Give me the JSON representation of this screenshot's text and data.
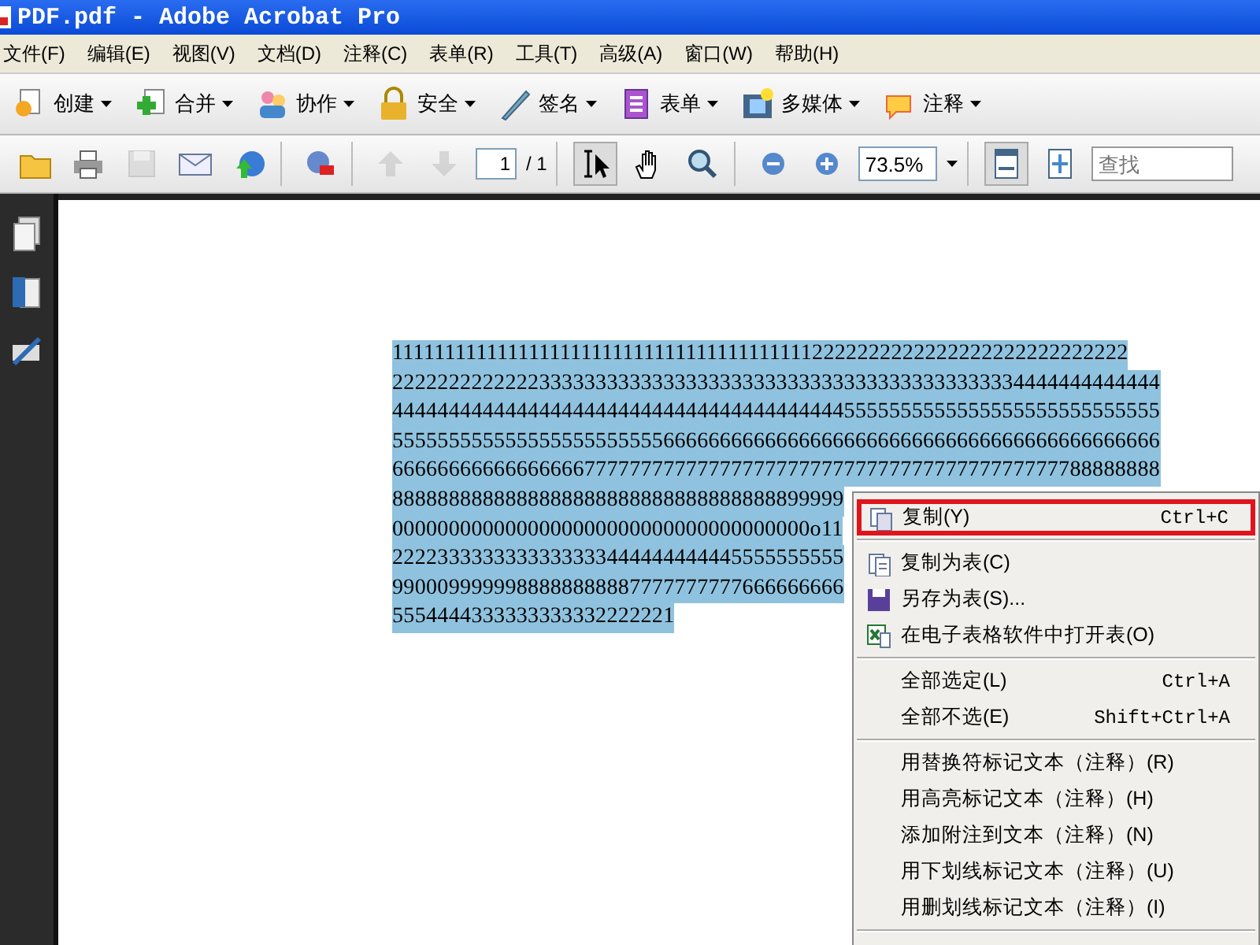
{
  "window": {
    "title": "PDF.pdf - Adobe Acrobat Pro"
  },
  "menu_bar": [
    "文件(F)",
    "编辑(E)",
    "视图(V)",
    "文档(D)",
    "注释(C)",
    "表单(R)",
    "工具(T)",
    "高级(A)",
    "窗口(W)",
    "帮助(H)"
  ],
  "task_toolbar": [
    {
      "label": "创建"
    },
    {
      "label": "合并"
    },
    {
      "label": "协作"
    },
    {
      "label": "安全"
    },
    {
      "label": "签名"
    },
    {
      "label": "表单"
    },
    {
      "label": "多媒体"
    },
    {
      "label": "注释"
    }
  ],
  "file_toolbar": [
    [
      {
        "kind": "button",
        "disabled": false,
        "pressed": false
      },
      {
        "kind": "button",
        "disabled": false,
        "pressed": false
      },
      {
        "kind": "button",
        "disabled": true,
        "pressed": false
      },
      {
        "kind": "button",
        "disabled": false,
        "pressed": false
      },
      {
        "kind": "button",
        "disabled": false,
        "pressed": false
      }
    ],
    [
      {
        "kind": "button",
        "disabled": false,
        "pressed": false
      }
    ],
    [
      {
        "kind": "button",
        "disabled": true,
        "pressed": false
      },
      {
        "kind": "button",
        "disabled": true,
        "pressed": false
      },
      {
        "kind": "page_field",
        "value": "1"
      },
      {
        "kind": "page_count",
        "text": "/ 1"
      }
    ],
    [
      {
        "kind": "button",
        "disabled": false,
        "pressed": true
      },
      {
        "kind": "button",
        "disabled": false,
        "pressed": false
      },
      {
        "kind": "button",
        "disabled": false,
        "pressed": false
      }
    ],
    [
      {
        "kind": "button",
        "disabled": false,
        "pressed": false
      },
      {
        "kind": "button",
        "disabled": false,
        "pressed": false
      },
      {
        "kind": "zoom_field",
        "value": "73.5%"
      }
    ],
    [
      {
        "kind": "button",
        "disabled": false,
        "pressed": true
      },
      {
        "kind": "button",
        "disabled": false,
        "pressed": false
      },
      {
        "kind": "search_field",
        "placeholder": "查找"
      }
    ]
  ],
  "document": {
    "selected_lines": [
      "11111111111111111111111111111111111111112222222222222222222222222222",
      "22222222222223333333333333333333333333333333333333333334444444444444",
      "44444444444444444444444444444444444444445555555555555555555555555555",
      "55555555555555555555555566666666666666666666666666666666666666666666",
      "66666666666666666777777777777777777777777777777777777777777788888888",
      "8888888888888888888888888888888888899999",
      "0000000000000000000000000000000000000o11",
      "2222333333333333333444444444445555555555",
      "9900099999988888888887777777777666666666",
      "5554444333333333332222221"
    ]
  },
  "context_menu": {
    "sections": [
      [
        {
          "label": "复制(Y)",
          "shortcut": "Ctrl+C",
          "highlighted": true
        }
      ],
      [
        {
          "label": "复制为表(C)",
          "highlighted": false
        },
        {
          "label": "另存为表(S)...",
          "highlighted": false
        },
        {
          "label": "在电子表格软件中打开表(O)",
          "highlighted": false
        }
      ],
      [
        {
          "label": "全部选定(L)",
          "shortcut": "Ctrl+A",
          "highlighted": false
        },
        {
          "label": "全部不选(E)",
          "shortcut": "Shift+Ctrl+A",
          "highlighted": false
        }
      ],
      [
        {
          "label": "用替换符标记文本（注释）(R)",
          "highlighted": false
        },
        {
          "label": "用高亮标记文本（注释）(H)",
          "highlighted": false
        },
        {
          "label": "添加附注到文本（注释）(N)",
          "highlighted": false
        },
        {
          "label": "用下划线标记文本（注释）(U)",
          "highlighted": false
        },
        {
          "label": "用删划线标记文本（注释）(I)",
          "highlighted": false
        }
      ]
    ]
  }
}
